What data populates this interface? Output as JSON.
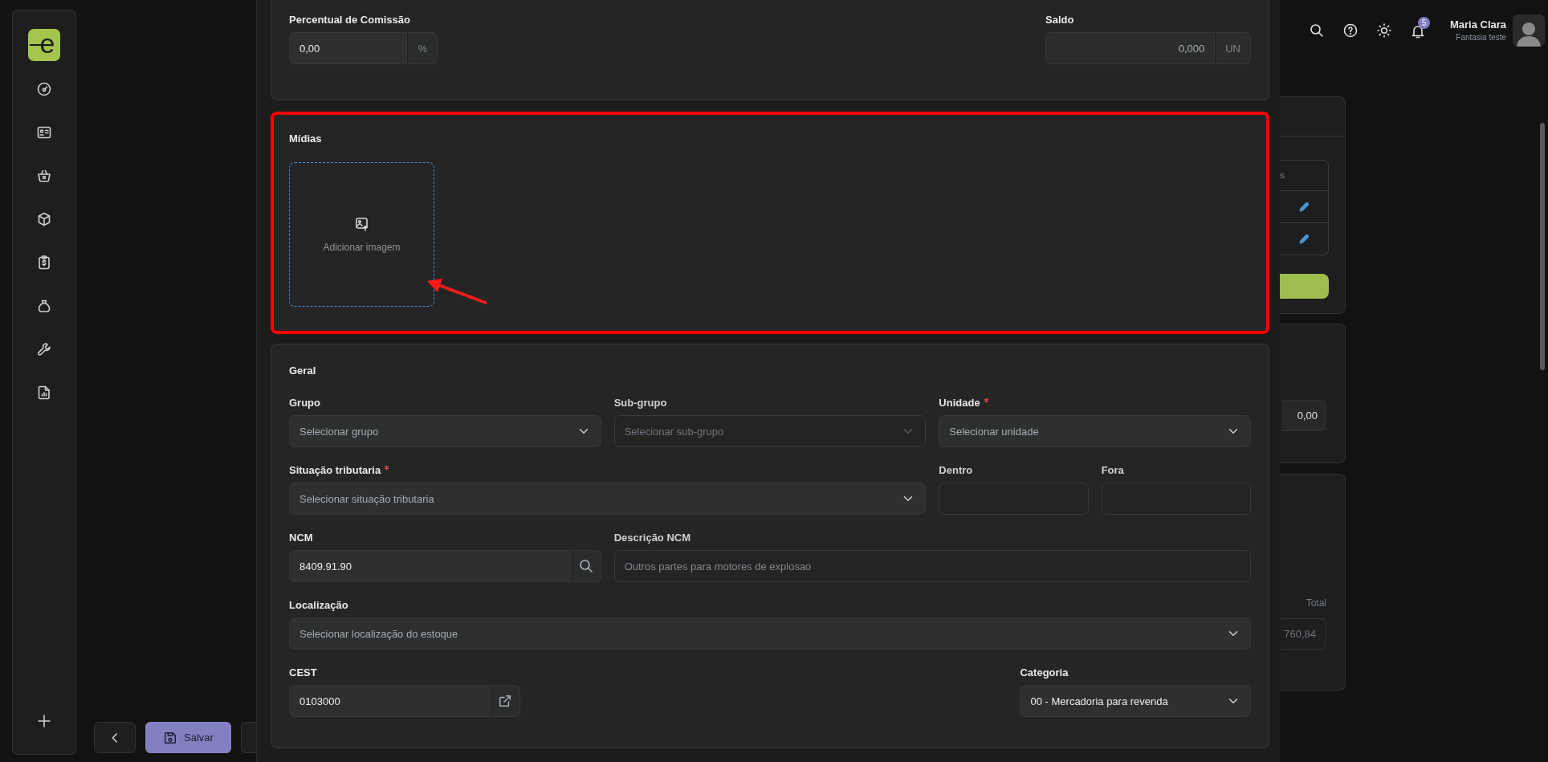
{
  "sidebar": {
    "logo_text": "e"
  },
  "header": {
    "notification_count": "5",
    "user_name": "Maria Clara",
    "user_subtitle": "Fantasia teste"
  },
  "footer": {
    "save_label": "Salvar"
  },
  "pricing": {
    "fields": [
      {
        "kind": "suffix",
        "label": "Percentual de Comissão",
        "value": "0,00",
        "suffix": "%",
        "readonly": false
      },
      {
        "kind": "suffix",
        "label": "Saldo",
        "value": "0,000",
        "suffix": "UN",
        "readonly": true
      }
    ]
  },
  "media": {
    "title": "Mídias",
    "add_image_label": "Adicionar imagem"
  },
  "general": {
    "title": "Geral",
    "fields": [
      {
        "kind": "select",
        "label": "Grupo",
        "placeholder": "Selecionar grupo",
        "required": false,
        "disabled": false
      },
      {
        "kind": "select",
        "label": "Sub-grupo",
        "placeholder": "Selecionar sub-grupo",
        "required": false,
        "disabled": true
      },
      {
        "kind": "select",
        "label": "Unidade",
        "placeholder": "Selecionar unidade",
        "required": true,
        "disabled": false
      },
      {
        "kind": "select",
        "label": "Situação tributaria",
        "placeholder": "Selecionar situação tributaria",
        "required": true,
        "disabled": false
      },
      {
        "kind": "text",
        "label": "Dentro",
        "required": false,
        "disabled": true
      },
      {
        "kind": "text",
        "label": "Fora",
        "required": false,
        "disabled": true
      },
      {
        "kind": "search",
        "label": "NCM",
        "value": "8409.91.90",
        "required": false,
        "disabled": false
      },
      {
        "kind": "text",
        "label": "Descrição NCM",
        "placeholder": "Outros partes para motores de explosao",
        "required": false,
        "disabled": true
      },
      {
        "kind": "select",
        "label": "Localização",
        "placeholder": "Selecionar localização do estoque",
        "required": false,
        "disabled": false
      },
      {
        "kind": "link",
        "label": "CEST",
        "value": "0103000",
        "required": false,
        "disabled": false
      },
      {
        "kind": "select",
        "label": "Categoria",
        "value": "00 - Mercadoria para revenda",
        "required": false,
        "disabled": false
      }
    ]
  },
  "background": {
    "column_fragment": "S",
    "amount": "0,00",
    "total_label": "Total",
    "total_value": "760,84"
  }
}
